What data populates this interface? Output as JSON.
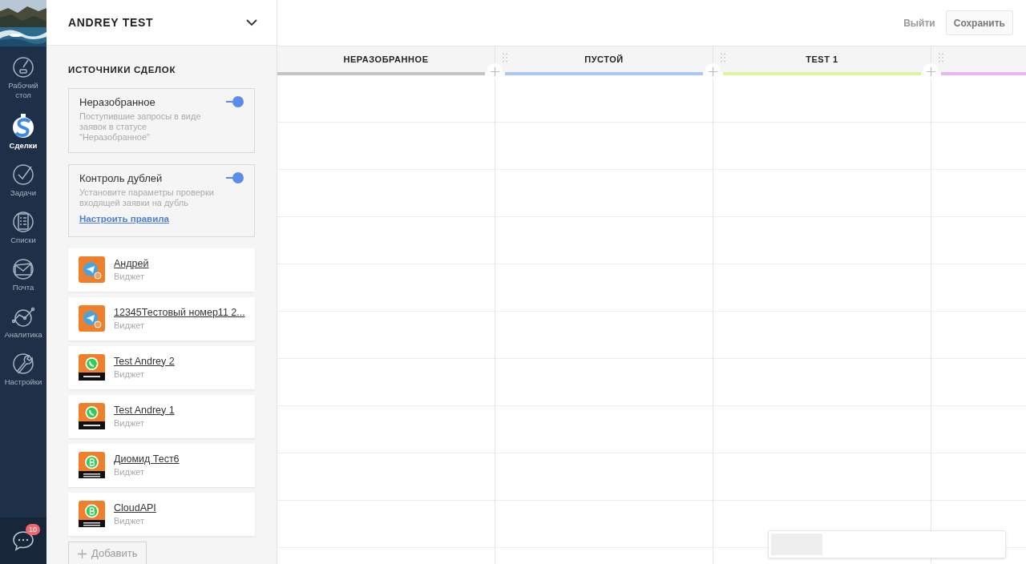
{
  "nav": {
    "items": [
      {
        "label": "Рабочий стол",
        "selected": false
      },
      {
        "label": "Сделки",
        "selected": true
      },
      {
        "label": "Задачи",
        "selected": false
      },
      {
        "label": "Списки",
        "selected": false
      },
      {
        "label": "Почта",
        "selected": false
      },
      {
        "label": "Аналитика",
        "selected": false
      },
      {
        "label": "Настройки",
        "selected": false
      }
    ],
    "chat_badge": "10"
  },
  "panel": {
    "title": "ANDREY TEST",
    "section_title": "ИСТОЧНИКИ СДЕЛОК",
    "sources": [
      {
        "title": "Неразобранное",
        "description": "Поступившие запросы в виде заявок в статусе \"Неразобранное\"",
        "on": true
      },
      {
        "title": "Контроль дублей",
        "description": "Установите параметры проверки входящей заявки на дубль",
        "on": true,
        "link": "Настроить правила"
      }
    ],
    "widgets": [
      {
        "name": "Андрей",
        "subtitle": "Виджет",
        "kind": "telegram"
      },
      {
        "name": "12345Тестовый номер11 2...",
        "subtitle": "Виджет",
        "kind": "telegram"
      },
      {
        "name": "Test Andrey 2",
        "subtitle": "Виджет",
        "kind": "whatsapp"
      },
      {
        "name": "Test Andrey 1",
        "subtitle": "Виджет",
        "kind": "whatsapp"
      },
      {
        "name": "Диомид Тест6",
        "subtitle": "Виджет",
        "kind": "business"
      },
      {
        "name": "CloudAPI",
        "subtitle": "Виджет",
        "kind": "business"
      }
    ],
    "add_button": "Добавить"
  },
  "toolbar": {
    "buttons": [
      {
        "label": "Выйти",
        "kind": "link"
      },
      {
        "label": "Сохранить",
        "kind": "button"
      }
    ]
  },
  "board": {
    "columns": [
      {
        "title": "НЕРАЗОБРАННОЕ",
        "color": "#c4c4c4"
      },
      {
        "title": "ПУСТОЙ",
        "color": "#a9c7f5"
      },
      {
        "title": "TEST 1",
        "color": "#def5a0"
      },
      {
        "color": "#e8b5f0"
      }
    ]
  }
}
